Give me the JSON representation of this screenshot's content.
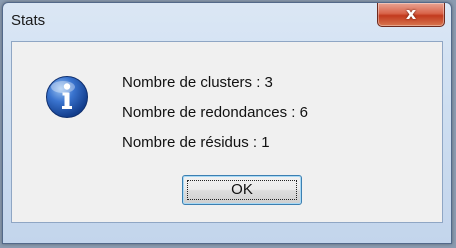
{
  "window": {
    "title": "Stats",
    "close_glyph": "x",
    "icon": "information-icon"
  },
  "message": {
    "lines": [
      "Nombre de clusters : 3",
      "Nombre de redondances : 6",
      "Nombre de résidus : 1"
    ]
  },
  "buttons": {
    "ok_label": "OK"
  },
  "colors": {
    "info_icon": "#2f62b8",
    "close_button": "#c9462a",
    "ok_focus_border": "#3c7fb1"
  }
}
